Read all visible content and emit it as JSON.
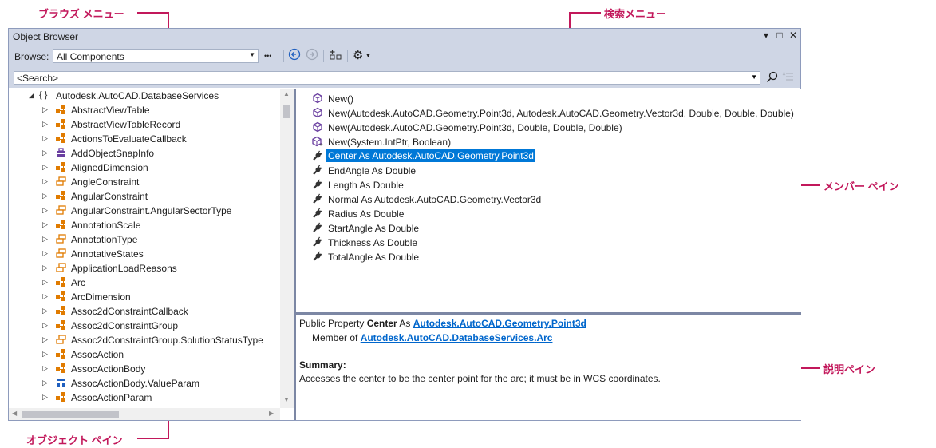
{
  "callouts": {
    "browse_menu": "ブラウズ メニュー",
    "search_menu": "検索メニュー",
    "member_pane": "メンバー ペイン",
    "description_pane": "説明ペイン",
    "object_pane": "オブジェクト ペイン"
  },
  "window": {
    "title": "Object Browser",
    "controls": [
      "▾",
      "□",
      "✕"
    ]
  },
  "toolbar": {
    "browse_label": "Browse:",
    "browse_value": "All Components",
    "more": "•••",
    "back": "◀",
    "forward": "▶",
    "add_reference": "+",
    "settings": "⚙"
  },
  "search": {
    "placeholder": "<Search>"
  },
  "tree": {
    "root": "Autodesk.AutoCAD.DatabaseServices",
    "items": [
      {
        "label": "AbstractViewTable",
        "icon": "class-icon"
      },
      {
        "label": "AbstractViewTableRecord",
        "icon": "class-icon"
      },
      {
        "label": "ActionsToEvaluateCallback",
        "icon": "class-icon"
      },
      {
        "label": "AddObjectSnapInfo",
        "icon": "delegate-icon"
      },
      {
        "label": "AlignedDimension",
        "icon": "class-icon"
      },
      {
        "label": "AngleConstraint",
        "icon": "enum-icon"
      },
      {
        "label": "AngularConstraint",
        "icon": "class-icon"
      },
      {
        "label": "AngularConstraint.AngularSectorType",
        "icon": "enum-icon"
      },
      {
        "label": "AnnotationScale",
        "icon": "class-icon"
      },
      {
        "label": "AnnotationType",
        "icon": "enum-icon"
      },
      {
        "label": "AnnotativeStates",
        "icon": "enum-icon"
      },
      {
        "label": "ApplicationLoadReasons",
        "icon": "enum-icon"
      },
      {
        "label": "Arc",
        "icon": "class-icon"
      },
      {
        "label": "ArcDimension",
        "icon": "class-icon"
      },
      {
        "label": "Assoc2dConstraintCallback",
        "icon": "class-icon"
      },
      {
        "label": "Assoc2dConstraintGroup",
        "icon": "class-icon"
      },
      {
        "label": "Assoc2dConstraintGroup.SolutionStatusType",
        "icon": "enum-icon"
      },
      {
        "label": "AssocAction",
        "icon": "class-icon"
      },
      {
        "label": "AssocActionBody",
        "icon": "class-icon"
      },
      {
        "label": "AssocActionBody.ValueParam",
        "icon": "struct-icon"
      },
      {
        "label": "AssocActionParam",
        "icon": "class-icon"
      }
    ]
  },
  "members": [
    {
      "label": "New()",
      "icon": "method-icon"
    },
    {
      "label": "New(Autodesk.AutoCAD.Geometry.Point3d, Autodesk.AutoCAD.Geometry.Vector3d, Double, Double, Double)",
      "icon": "method-icon"
    },
    {
      "label": "New(Autodesk.AutoCAD.Geometry.Point3d, Double, Double, Double)",
      "icon": "method-icon"
    },
    {
      "label": "New(System.IntPtr, Boolean)",
      "icon": "method-protected-icon"
    },
    {
      "label": "Center As Autodesk.AutoCAD.Geometry.Point3d",
      "icon": "property-icon",
      "selected": true
    },
    {
      "label": "EndAngle As Double",
      "icon": "property-icon"
    },
    {
      "label": "Length As Double",
      "icon": "property-icon"
    },
    {
      "label": "Normal As Autodesk.AutoCAD.Geometry.Vector3d",
      "icon": "property-icon"
    },
    {
      "label": "Radius As Double",
      "icon": "property-icon"
    },
    {
      "label": "StartAngle As Double",
      "icon": "property-icon"
    },
    {
      "label": "Thickness As Double",
      "icon": "property-icon"
    },
    {
      "label": "TotalAngle As Double",
      "icon": "property-icon"
    }
  ],
  "description": {
    "prefix": "Public Property ",
    "name": "Center",
    "as": " As ",
    "type_link": "Autodesk.AutoCAD.Geometry.Point3d",
    "member_of": "Member of ",
    "ns_link": "Autodesk.AutoCAD.DatabaseServices",
    "dot": ".",
    "class_link": "Arc",
    "summary_label": "Summary:",
    "summary": "Accesses the center to be the center point for the arc; it must be in WCS coordinates."
  }
}
